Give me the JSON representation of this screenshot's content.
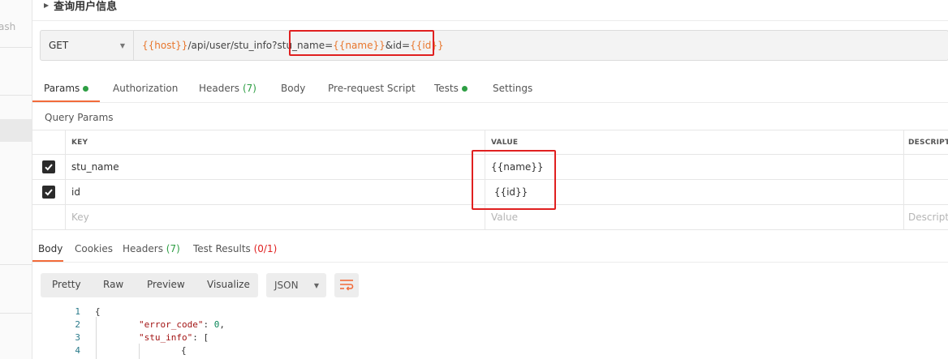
{
  "sidebar": {
    "fragment": "ash"
  },
  "request": {
    "title": "查询用户信息",
    "method": "GET",
    "url": {
      "host_var": "{{host}}",
      "path": "/api/user/stu_info?stu_name=",
      "name_var": "{{name}}",
      "mid": "&id= ",
      "id_var": "{{id}}"
    }
  },
  "tabs": [
    {
      "label": "Params",
      "dot": true
    },
    {
      "label": "Authorization"
    },
    {
      "label": "Headers",
      "count": "(7)"
    },
    {
      "label": "Body"
    },
    {
      "label": "Pre-request Script"
    },
    {
      "label": "Tests",
      "dot": true
    },
    {
      "label": "Settings"
    }
  ],
  "query_params": {
    "title": "Query Params",
    "headers": {
      "key": "KEY",
      "value": "VALUE",
      "description": "DESCRIPTION"
    },
    "rows": [
      {
        "checked": true,
        "key": "stu_name",
        "value": "{{name}}"
      },
      {
        "checked": true,
        "key": "id",
        "value": " {{id}}"
      }
    ],
    "placeholder": {
      "key": "Key",
      "value": "Value",
      "description": "Description"
    }
  },
  "response": {
    "tabs": [
      {
        "label": "Body"
      },
      {
        "label": "Cookies"
      },
      {
        "label": "Headers",
        "count": "(7)"
      },
      {
        "label": "Test Results",
        "count": "(0/1)"
      }
    ],
    "views": [
      "Pretty",
      "Raw",
      "Preview",
      "Visualize"
    ],
    "format": "JSON",
    "wrap_icon": "wrap-lines-icon",
    "code_lines": [
      {
        "num": "1",
        "text": "{"
      },
      {
        "num": "2",
        "key": "\"error_code\"",
        "sep": ": ",
        "val": "0",
        "tail": ","
      },
      {
        "num": "3",
        "key": "\"stu_info\"",
        "sep": ": [",
        "val": "",
        "tail": ""
      },
      {
        "num": "4",
        "text": "{"
      }
    ]
  },
  "colors": {
    "accent": "#f26b3a",
    "variable": "#e8762c",
    "highlight_box": "#e02020",
    "status_ok": "#2e9e44"
  }
}
